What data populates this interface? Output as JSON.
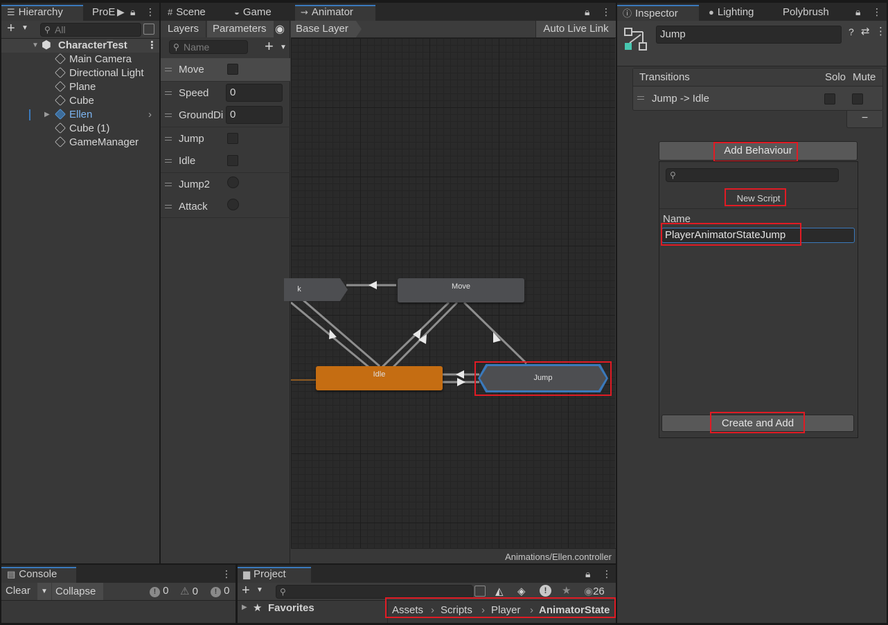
{
  "hierarchy": {
    "tab_label": "Hierarchy",
    "tab2_label": "ProE",
    "search_placeholder": "All",
    "scene_name": "CharacterTest",
    "items": [
      {
        "label": "Main Camera"
      },
      {
        "label": "Directional Light"
      },
      {
        "label": "Plane"
      },
      {
        "label": "Cube"
      },
      {
        "label": "Ellen"
      },
      {
        "label": "Cube (1)"
      },
      {
        "label": "GameManager"
      }
    ]
  },
  "center": {
    "tabs": [
      "Scene",
      "Game",
      "Animator"
    ],
    "layers_tab": "Layers",
    "parameters_tab": "Parameters",
    "search_placeholder": "Name",
    "breadcrumb": "Base Layer",
    "auto_live_link": "Auto Live Link",
    "footer_path": "Animations/Ellen.controller",
    "parameters": [
      {
        "name": "Move",
        "type": "bool"
      },
      {
        "name": "Speed",
        "type": "float",
        "value": "0"
      },
      {
        "name": "GroundDi",
        "type": "float",
        "value": "0"
      },
      {
        "name": "Jump",
        "type": "bool"
      },
      {
        "name": "Idle",
        "type": "bool"
      },
      {
        "name": "Jump2",
        "type": "trigger"
      },
      {
        "name": "Attack",
        "type": "trigger"
      }
    ],
    "nodes": {
      "attack_partial": "k",
      "move": "Move",
      "idle": "Idle",
      "jump": "Jump"
    },
    "colors": {
      "idle_node": "#c56d12",
      "selected_outline": "#3a79bb",
      "highlight": "#e01b24"
    }
  },
  "inspector": {
    "tabs": [
      "Inspector",
      "Lighting",
      "Polybrush"
    ],
    "state_name": "Jump",
    "transitions_header": "Transitions",
    "solo_label": "Solo",
    "mute_label": "Mute",
    "transition_row": "Jump -> Idle",
    "minus_label": "−",
    "add_behaviour": "Add Behaviour",
    "new_script": "New Script",
    "name_label": "Name",
    "name_value": "PlayerAnimatorStateJump",
    "create_and_add": "Create and Add"
  },
  "console": {
    "tab_label": "Console",
    "clear": "Clear",
    "collapse": "Collapse",
    "error_count": "0",
    "warning_count": "0",
    "info_count": "0"
  },
  "project": {
    "tab_label": "Project",
    "hidden_count": "26",
    "favorites": "Favorites",
    "breadcrumb": [
      "Assets",
      "Scripts",
      "Player",
      "AnimatorState"
    ]
  }
}
